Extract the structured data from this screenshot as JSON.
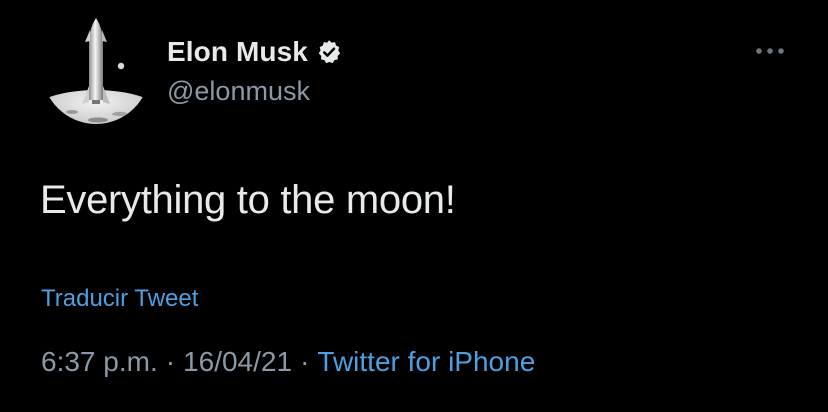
{
  "tweet": {
    "author": {
      "display_name": "Elon Musk",
      "handle": "@elonmusk",
      "verified": true,
      "avatar_icon": "starship-on-moon-avatar"
    },
    "text": "Everything to the moon!",
    "translate_label": "Traducir Tweet",
    "time": "6:37 p.m.",
    "date": "16/04/21",
    "separator": "·",
    "source": "Twitter for iPhone",
    "more_icon": "more-dots-icon"
  },
  "colors": {
    "background": "#000000",
    "primary_text": "#e7e9ea",
    "secondary_text": "#8b98a5",
    "link": "#4da0e0",
    "verified_badge": "#e7e9ea"
  }
}
